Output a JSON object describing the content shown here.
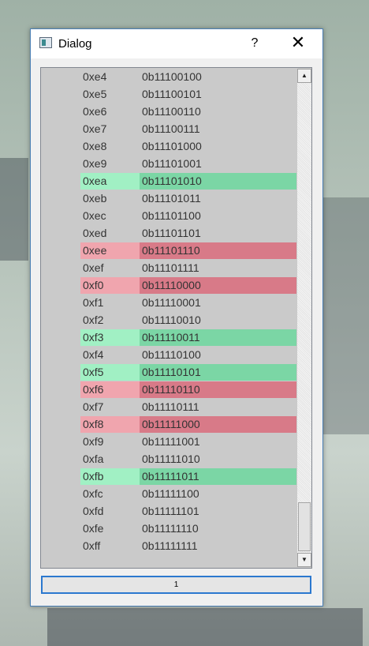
{
  "window": {
    "title": "Dialog",
    "help_label": "?",
    "close_label": "✕"
  },
  "list": {
    "rows": [
      {
        "hex": "0xe4",
        "bin": "0b11100100",
        "status": "none"
      },
      {
        "hex": "0xe5",
        "bin": "0b11100101",
        "status": "none"
      },
      {
        "hex": "0xe6",
        "bin": "0b11100110",
        "status": "none"
      },
      {
        "hex": "0xe7",
        "bin": "0b11100111",
        "status": "none"
      },
      {
        "hex": "0xe8",
        "bin": "0b11101000",
        "status": "none"
      },
      {
        "hex": "0xe9",
        "bin": "0b11101001",
        "status": "none"
      },
      {
        "hex": "0xea",
        "bin": "0b11101010",
        "status": "green"
      },
      {
        "hex": "0xeb",
        "bin": "0b11101011",
        "status": "none"
      },
      {
        "hex": "0xec",
        "bin": "0b11101100",
        "status": "none"
      },
      {
        "hex": "0xed",
        "bin": "0b11101101",
        "status": "none"
      },
      {
        "hex": "0xee",
        "bin": "0b11101110",
        "status": "red"
      },
      {
        "hex": "0xef",
        "bin": "0b11101111",
        "status": "none"
      },
      {
        "hex": "0xf0",
        "bin": "0b11110000",
        "status": "red"
      },
      {
        "hex": "0xf1",
        "bin": "0b11110001",
        "status": "none"
      },
      {
        "hex": "0xf2",
        "bin": "0b11110010",
        "status": "none"
      },
      {
        "hex": "0xf3",
        "bin": "0b11110011",
        "status": "green"
      },
      {
        "hex": "0xf4",
        "bin": "0b11110100",
        "status": "none"
      },
      {
        "hex": "0xf5",
        "bin": "0b11110101",
        "status": "green"
      },
      {
        "hex": "0xf6",
        "bin": "0b11110110",
        "status": "red"
      },
      {
        "hex": "0xf7",
        "bin": "0b11110111",
        "status": "none"
      },
      {
        "hex": "0xf8",
        "bin": "0b11111000",
        "status": "red"
      },
      {
        "hex": "0xf9",
        "bin": "0b11111001",
        "status": "none"
      },
      {
        "hex": "0xfa",
        "bin": "0b11111010",
        "status": "none"
      },
      {
        "hex": "0xfb",
        "bin": "0b11111011",
        "status": "green"
      },
      {
        "hex": "0xfc",
        "bin": "0b11111100",
        "status": "none"
      },
      {
        "hex": "0xfd",
        "bin": "0b11111101",
        "status": "none"
      },
      {
        "hex": "0xfe",
        "bin": "0b11111110",
        "status": "none"
      },
      {
        "hex": "0xff",
        "bin": "0b11111111",
        "status": "none"
      }
    ]
  },
  "scrollbar": {
    "up_icon": "scroll-up-arrow-icon",
    "down_icon": "scroll-down-arrow-icon",
    "up_glyph": "▲",
    "down_glyph": "▼"
  },
  "footer": {
    "button_label": "1"
  },
  "colors": {
    "green_hex": "#a1f0c4",
    "green_bin": "#7bd6a5",
    "red_hex": "#f0a5ae",
    "red_bin": "#d87a88",
    "list_bg": "#cacaca",
    "focus_border": "#2b78cf"
  }
}
